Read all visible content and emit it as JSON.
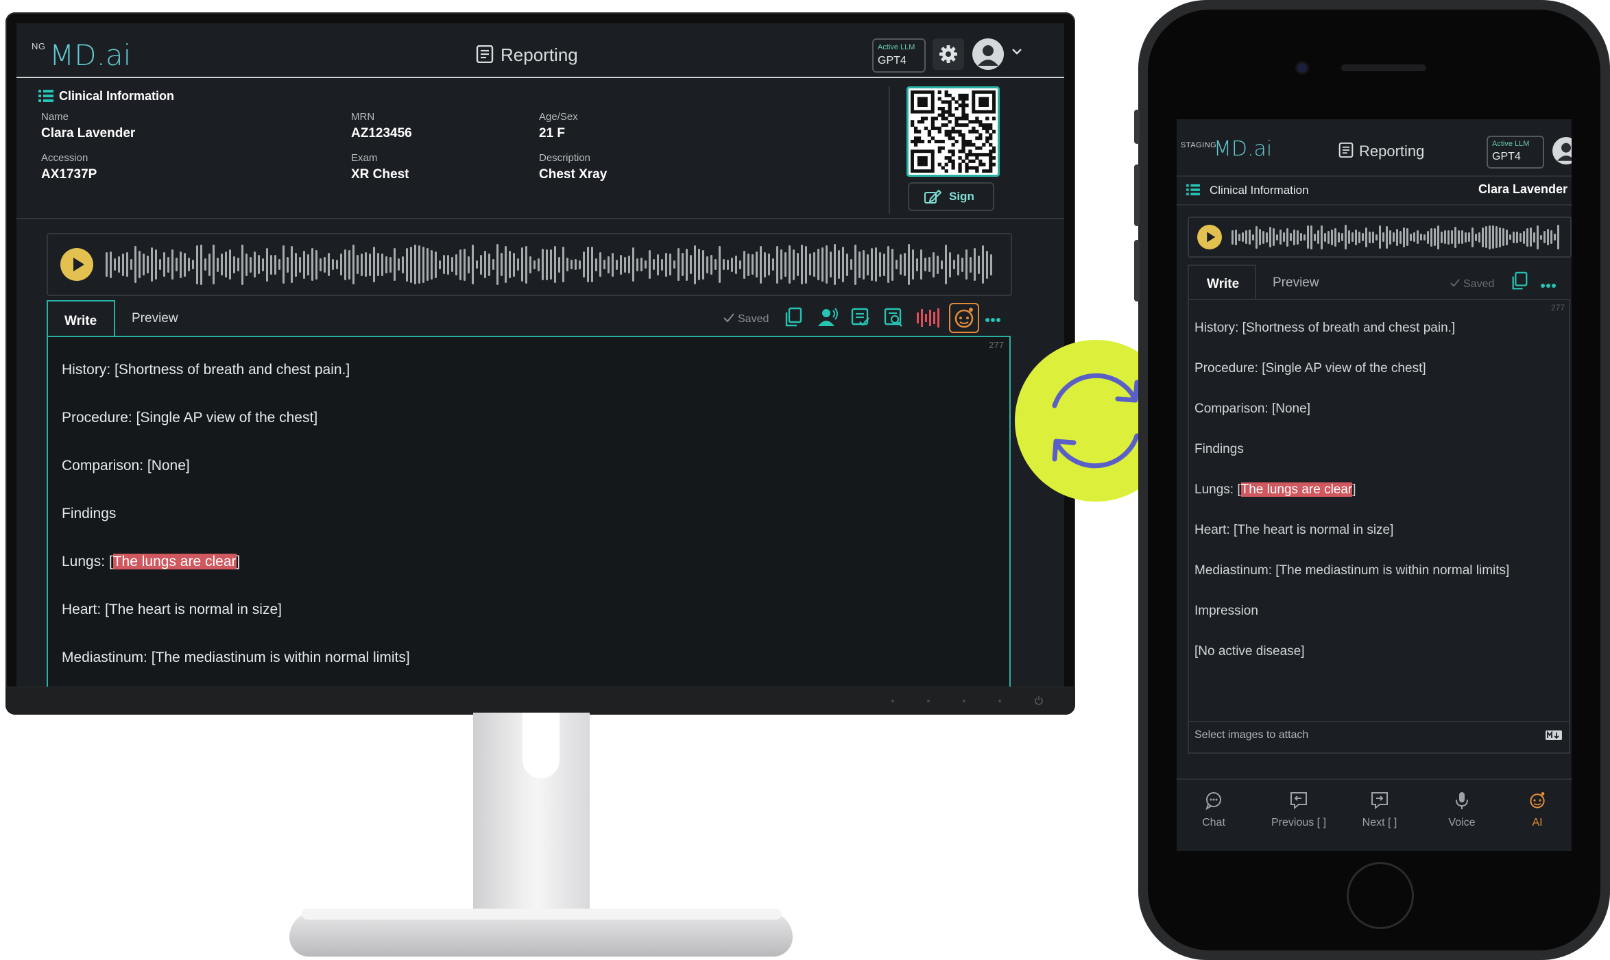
{
  "desktop": {
    "logo_prefix": "NG",
    "logo": "MD.ai",
    "title": "Reporting",
    "llm_label": "Active LLM",
    "llm_value": "GPT4",
    "clinical_header": "Clinical Information",
    "fields": {
      "name_label": "Name",
      "name_value": "Clara Lavender",
      "mrn_label": "MRN",
      "mrn_value": "AZ123456",
      "age_label": "Age/Sex",
      "age_value": "21 F",
      "accession_label": "Accession",
      "accession_value": "AX1737P",
      "exam_label": "Exam",
      "exam_value": "XR Chest",
      "description_label": "Description",
      "description_value": "Chest Xray"
    },
    "sign_label": "Sign",
    "tabs": {
      "write": "Write",
      "preview": "Preview"
    },
    "saved_label": "Saved",
    "char_count": "277",
    "report_lines": {
      "history": "History: [Shortness of breath and chest pain.]",
      "procedure": "Procedure: [Single AP view of the chest]",
      "comparison": "Comparison: [None]",
      "findings": "Findings",
      "lungs_prefix": "Lungs: [",
      "lungs_highlight": "The lungs are clear",
      "lungs_suffix": "]",
      "heart": "Heart: [The heart is normal in size]",
      "mediastinum": "Mediastinum: [The mediastinum is within normal limits]"
    }
  },
  "mobile": {
    "logo_prefix": "STAGING",
    "logo": "MD.ai",
    "title": "Reporting",
    "llm_label": "Active LLM",
    "llm_value": "GPT4",
    "clinical_header": "Clinical Information",
    "patient_name": "Clara Lavender",
    "tabs": {
      "write": "Write",
      "preview": "Preview"
    },
    "saved_label": "Saved",
    "char_count": "277",
    "report_lines": {
      "history": "History: [Shortness of breath and chest pain.]",
      "procedure": "Procedure: [Single AP view of the chest]",
      "comparison": "Comparison: [None]",
      "findings": "Findings",
      "lungs_prefix": "Lungs: [",
      "lungs_highlight": "The lungs are clear",
      "lungs_suffix": "]",
      "heart": "Heart: [The heart is normal in size]",
      "mediastinum": "Mediastinum: [The mediastinum is within normal limits]",
      "impression": "Impression",
      "impression_text": "[No active disease]"
    },
    "attach_label": "Select images to attach",
    "nav": {
      "chat": "Chat",
      "previous": "Previous [ ]",
      "next": "Next [ ]",
      "voice": "Voice",
      "ai": "AI"
    }
  },
  "colors": {
    "accent_teal": "#27b3a3",
    "highlight_red": "#d0585f",
    "play_yellow": "#e3c150",
    "sync_green": "#dcef3a",
    "sync_icon": "#5a5fc7"
  }
}
